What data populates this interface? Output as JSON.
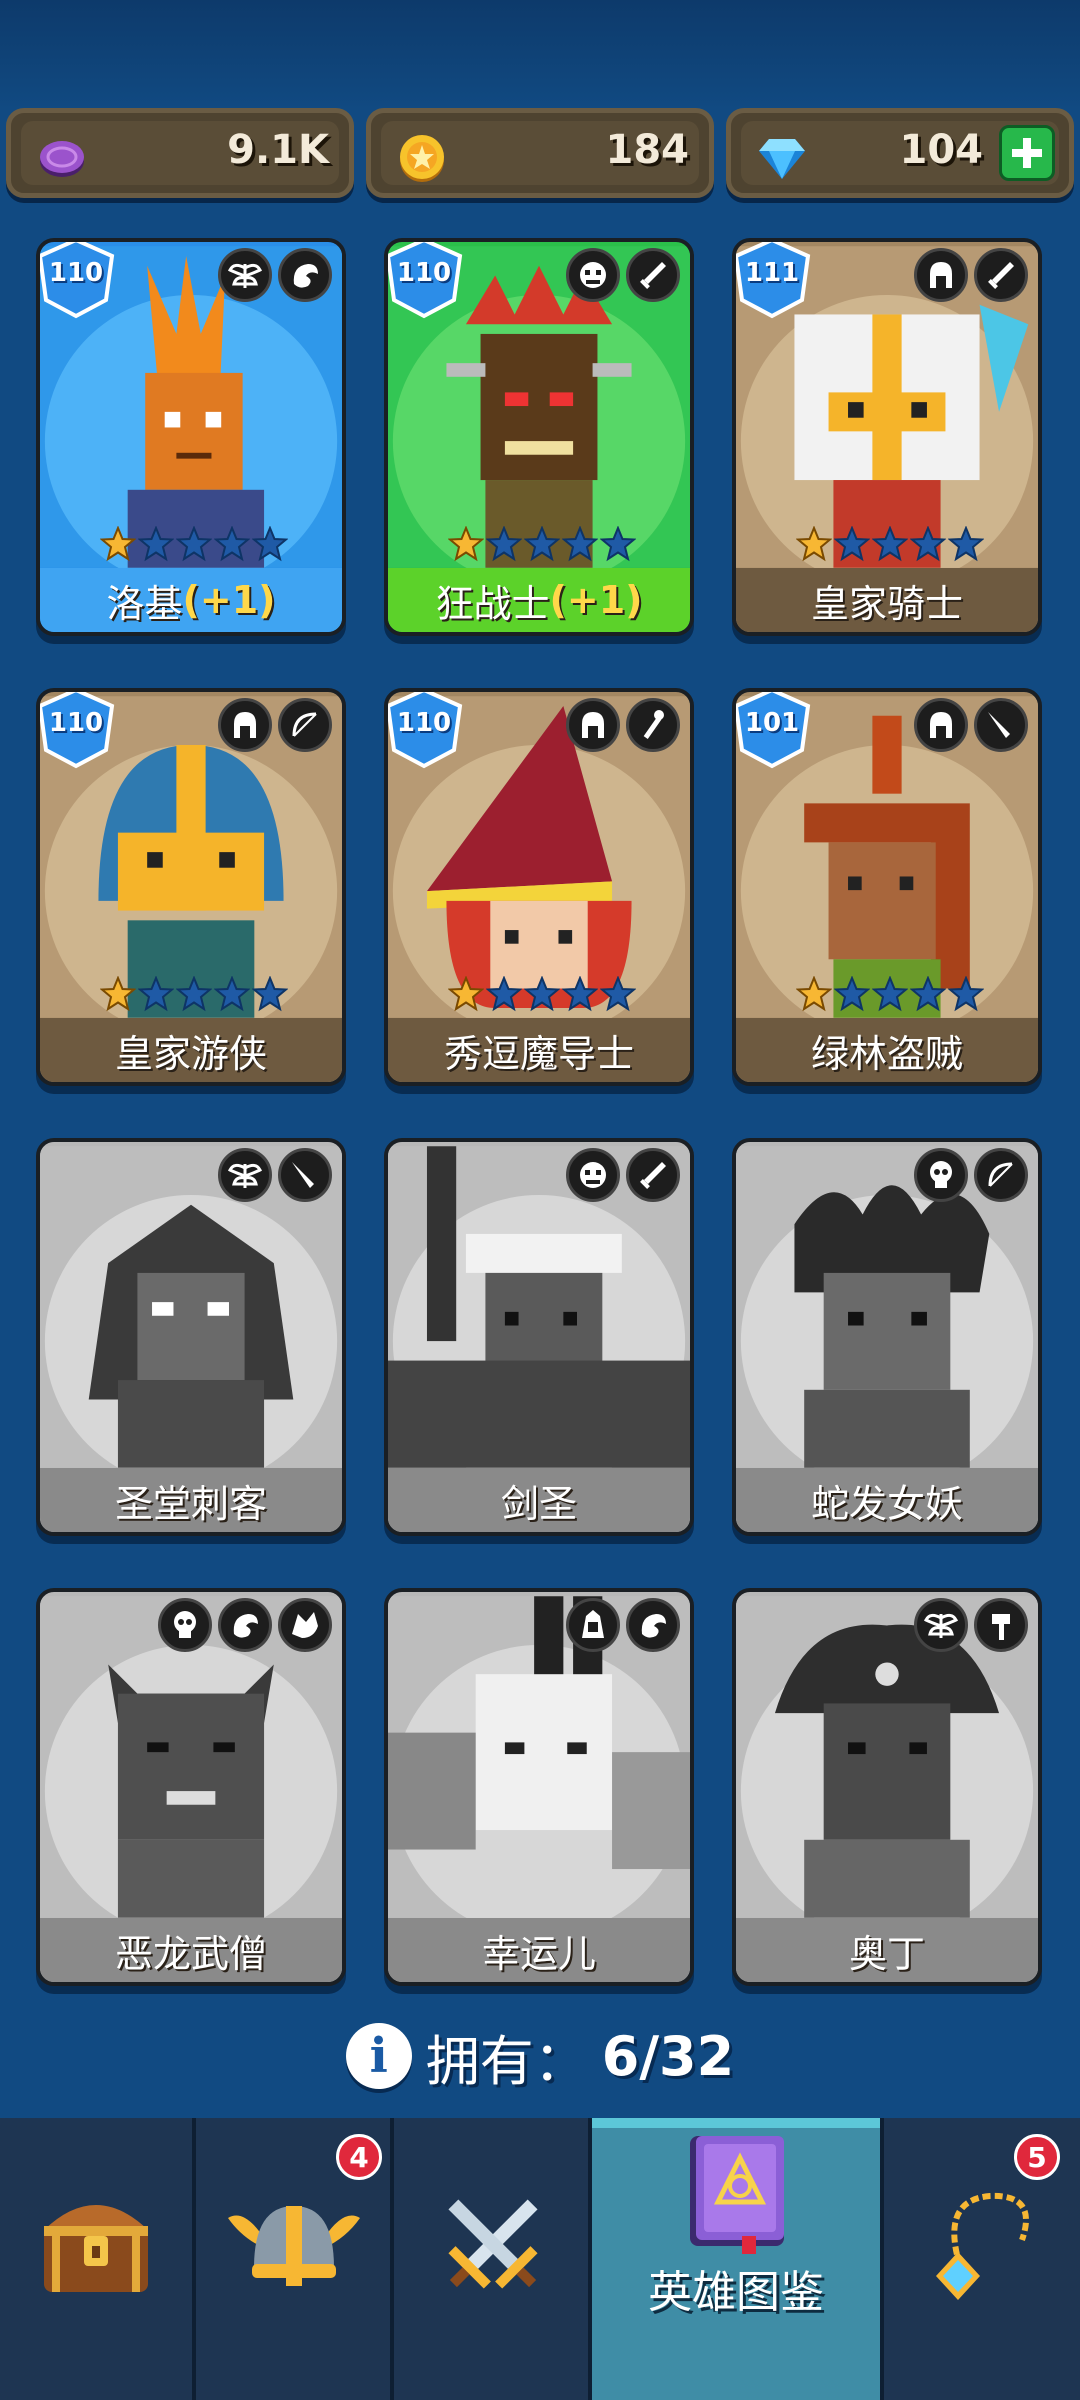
{
  "currency": {
    "gem_pink": "9.1K",
    "gold": "184",
    "diamonds": "104",
    "add_icon": "plus-icon"
  },
  "heroes": [
    {
      "name": "洛基",
      "plus": "(+1)",
      "level": "110",
      "stars": 1,
      "max_stars": 5,
      "style": "blue",
      "badges": [
        "wings-icon",
        "dragon-icon"
      ]
    },
    {
      "name": "狂战士",
      "plus": "(+1)",
      "level": "110",
      "stars": 1,
      "max_stars": 5,
      "style": "green",
      "badges": [
        "orc-mask-icon",
        "sword-icon"
      ]
    },
    {
      "name": "皇家骑士",
      "plus": "",
      "level": "111",
      "stars": 1,
      "max_stars": 5,
      "style": "brown",
      "badges": [
        "helmet-icon",
        "sword-icon"
      ]
    },
    {
      "name": "皇家游侠",
      "plus": "",
      "level": "110",
      "stars": 1,
      "max_stars": 5,
      "style": "brown",
      "badges": [
        "helmet-icon",
        "bow-icon"
      ]
    },
    {
      "name": "秀逗魔导士",
      "plus": "",
      "level": "110",
      "stars": 1,
      "max_stars": 5,
      "style": "brown",
      "badges": [
        "helmet-icon",
        "staff-icon"
      ]
    },
    {
      "name": "绿林盗贼",
      "plus": "",
      "level": "101",
      "stars": 1,
      "max_stars": 5,
      "style": "brown",
      "badges": [
        "helmet-icon",
        "dagger-icon"
      ]
    },
    {
      "name": "圣堂刺客",
      "plus": "",
      "level": "",
      "stars": 0,
      "max_stars": 0,
      "style": "gray",
      "badges": [
        "wings-icon",
        "dagger-icon"
      ]
    },
    {
      "name": "剑圣",
      "plus": "",
      "level": "",
      "stars": 0,
      "max_stars": 0,
      "style": "gray",
      "badges": [
        "orc-mask-icon",
        "sword-icon"
      ]
    },
    {
      "name": "蛇发女妖",
      "plus": "",
      "level": "",
      "stars": 0,
      "max_stars": 0,
      "style": "gray",
      "badges": [
        "skull-icon",
        "bow-icon"
      ]
    },
    {
      "name": "恶龙武僧",
      "plus": "",
      "level": "",
      "stars": 0,
      "max_stars": 0,
      "style": "gray",
      "badges": [
        "skull-icon",
        "dragon-icon",
        "dragon-head-icon"
      ]
    },
    {
      "name": "幸运儿",
      "plus": "",
      "level": "",
      "stars": 0,
      "max_stars": 0,
      "style": "gray",
      "badges": [
        "elf-icon",
        "dragon-icon"
      ]
    },
    {
      "name": "奥丁",
      "plus": "",
      "level": "",
      "stars": 0,
      "max_stars": 0,
      "style": "gray",
      "badges": [
        "wings-icon",
        "hammer-icon"
      ]
    }
  ],
  "owned": {
    "label": "拥有：",
    "count": "6/32"
  },
  "nav": {
    "tabs": [
      {
        "id": "chest",
        "icon": "treasure-chest-icon",
        "label": "",
        "badge": ""
      },
      {
        "id": "heroes",
        "icon": "viking-helmet-icon",
        "label": "",
        "badge": "4"
      },
      {
        "id": "battle",
        "icon": "crossed-swords-icon",
        "label": "",
        "badge": ""
      },
      {
        "id": "codex",
        "icon": "spellbook-icon",
        "label": "英雄图鉴",
        "badge": "",
        "active": true
      },
      {
        "id": "amulet",
        "icon": "amulet-icon",
        "label": "",
        "badge": "5"
      }
    ]
  },
  "colors": {
    "background": "#114a82",
    "card_blue": "#3fa4f2",
    "card_green": "#5cd22a",
    "card_brown": "#6e5a40",
    "card_locked": "#8a8a8a",
    "star_filled": "#f7b733",
    "star_empty": "#1f5aa6"
  }
}
